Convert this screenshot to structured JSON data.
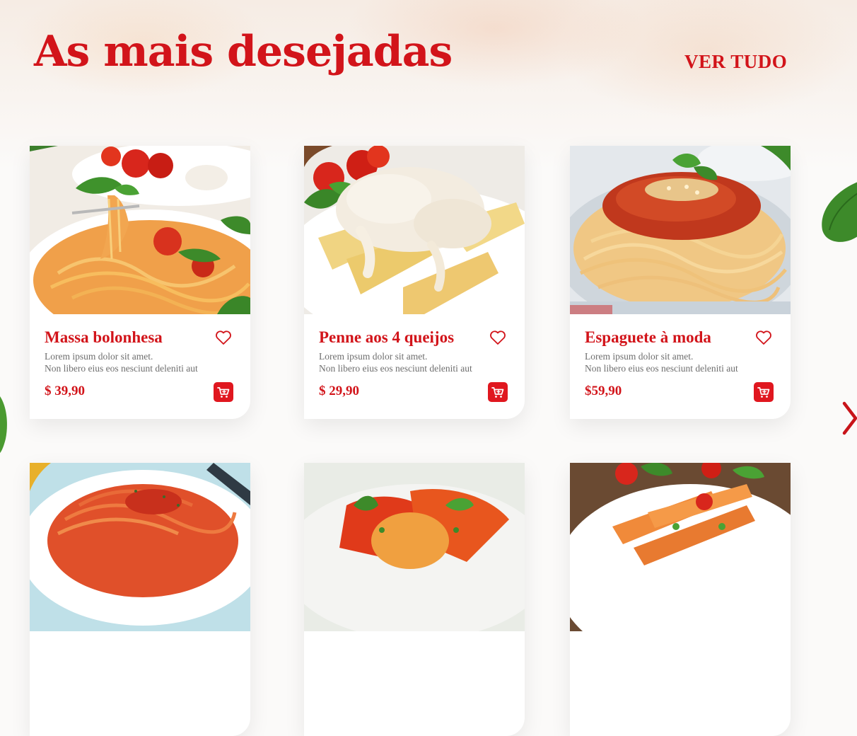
{
  "section": {
    "title": "As mais desejadas",
    "see_all_label": "VER TUDO"
  },
  "colors": {
    "accent": "#d2141a",
    "cart_button": "#e0171f",
    "description_text": "#6e6e6e"
  },
  "icons": {
    "favorite": "heart-outline-icon",
    "add_to_cart": "cart-icon",
    "next": "chevron-right-icon"
  },
  "products": [
    {
      "name": "Massa bolonhesa",
      "desc_line1": "Lorem ipsum dolor sit amet.",
      "desc_line2": "Non libero eius eos nesciunt deleniti aut",
      "price": "$ 39,90"
    },
    {
      "name": "Penne aos 4 queijos",
      "desc_line1": "Lorem ipsum dolor sit amet.",
      "desc_line2": "Non libero eius eos nesciunt deleniti aut",
      "price": "$ 29,90"
    },
    {
      "name": "Espaguete à moda",
      "desc_line1": "Lorem ipsum dolor sit amet.",
      "desc_line2": "Non libero eius eos nesciunt deleniti aut",
      "price": "$59,90"
    },
    {
      "name": "",
      "desc_line1": "",
      "desc_line2": "",
      "price": ""
    },
    {
      "name": "",
      "desc_line1": "",
      "desc_line2": "",
      "price": ""
    },
    {
      "name": "",
      "desc_line1": "",
      "desc_line2": "",
      "price": ""
    }
  ]
}
